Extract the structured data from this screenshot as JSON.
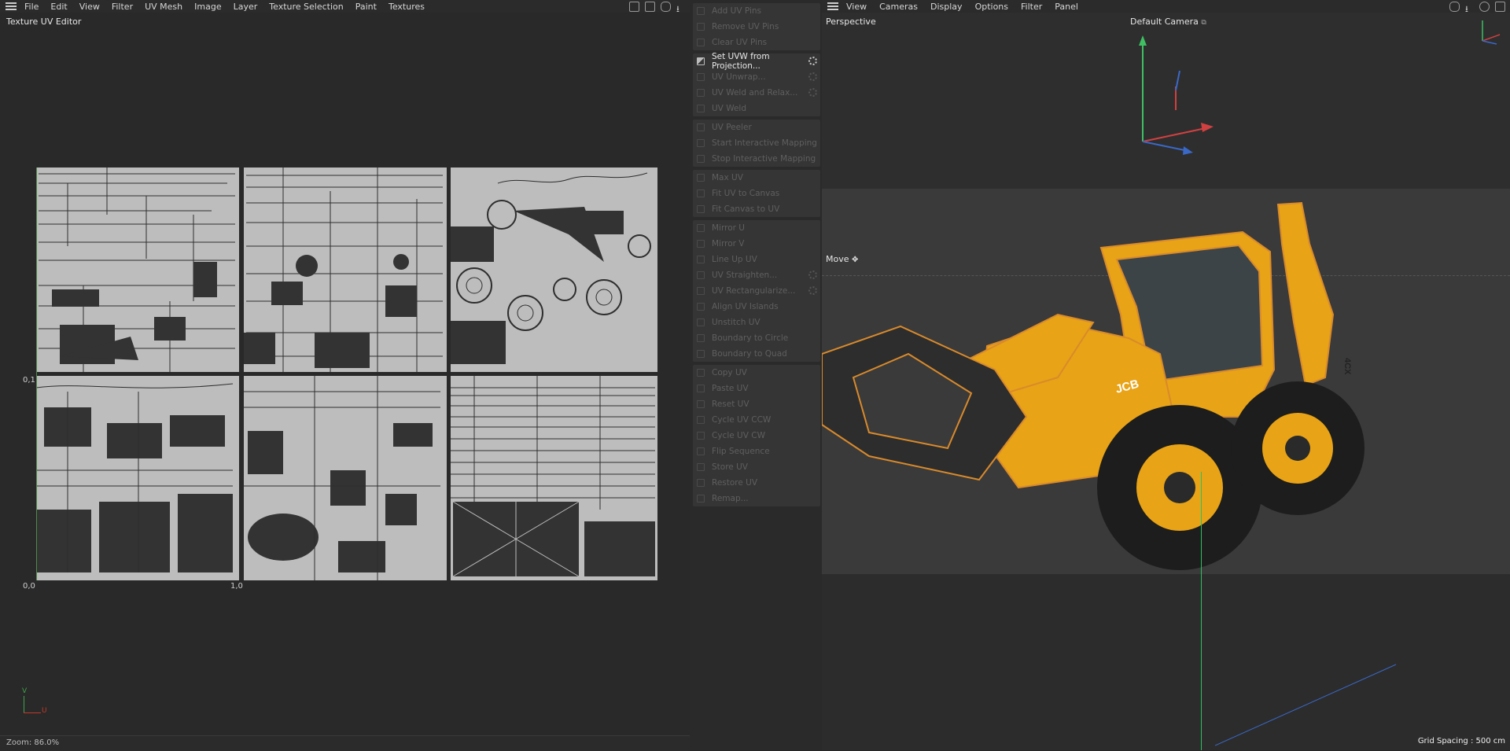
{
  "uv_editor": {
    "menu": [
      "File",
      "Edit",
      "View",
      "Filter",
      "UV Mesh",
      "Image",
      "Layer",
      "Texture Selection",
      "Paint",
      "Textures"
    ],
    "title": "Texture UV Editor",
    "coord_origin": "0,0",
    "coord_u": "1,0",
    "coord_v": "0,1",
    "axis_v": "V",
    "axis_u": "U",
    "zoom": "Zoom: 86.0%",
    "tool_icons": [
      "histogram-icon",
      "lock-icon",
      "hand-icon",
      "down-arrow-icon"
    ]
  },
  "uv_commands": {
    "groups": [
      [
        {
          "label": "Add UV Pins",
          "enabled": false,
          "gear": false
        },
        {
          "label": "Remove UV Pins",
          "enabled": false,
          "gear": false
        },
        {
          "label": "Clear UV Pins",
          "enabled": false,
          "gear": false
        }
      ],
      [
        {
          "label": "Set UVW from Projection...",
          "enabled": true,
          "gear": true
        },
        {
          "label": "UV Unwrap...",
          "enabled": false,
          "gear": true
        },
        {
          "label": "UV Weld and Relax...",
          "enabled": false,
          "gear": true
        },
        {
          "label": "UV Weld",
          "enabled": false,
          "gear": false
        }
      ],
      [
        {
          "label": "UV Peeler",
          "enabled": false,
          "gear": false
        },
        {
          "label": "Start Interactive Mapping",
          "enabled": false,
          "gear": false
        },
        {
          "label": "Stop Interactive Mapping",
          "enabled": false,
          "gear": false
        }
      ],
      [
        {
          "label": "Max UV",
          "enabled": false,
          "gear": false
        },
        {
          "label": "Fit UV to Canvas",
          "enabled": false,
          "gear": false
        },
        {
          "label": "Fit Canvas to UV",
          "enabled": false,
          "gear": false
        }
      ],
      [
        {
          "label": "Mirror U",
          "enabled": false,
          "gear": false
        },
        {
          "label": "Mirror V",
          "enabled": false,
          "gear": false
        },
        {
          "label": "Line Up UV",
          "enabled": false,
          "gear": false
        },
        {
          "label": "UV Straighten...",
          "enabled": false,
          "gear": true
        },
        {
          "label": "UV Rectangularize...",
          "enabled": false,
          "gear": true
        },
        {
          "label": "Align UV Islands",
          "enabled": false,
          "gear": false
        },
        {
          "label": "Unstitch UV",
          "enabled": false,
          "gear": false
        },
        {
          "label": "Boundary to Circle",
          "enabled": false,
          "gear": false
        },
        {
          "label": "Boundary to Quad",
          "enabled": false,
          "gear": false
        }
      ],
      [
        {
          "label": "Copy UV",
          "enabled": false,
          "gear": false
        },
        {
          "label": "Paste UV",
          "enabled": false,
          "gear": false
        },
        {
          "label": "Reset UV",
          "enabled": false,
          "gear": false
        },
        {
          "label": "Cycle UV CCW",
          "enabled": false,
          "gear": false
        },
        {
          "label": "Cycle UV CW",
          "enabled": false,
          "gear": false
        },
        {
          "label": "Flip Sequence",
          "enabled": false,
          "gear": false
        },
        {
          "label": "Store UV",
          "enabled": false,
          "gear": false
        },
        {
          "label": "Restore UV",
          "enabled": false,
          "gear": false
        },
        {
          "label": "Remap...",
          "enabled": false,
          "gear": false
        }
      ]
    ]
  },
  "viewport": {
    "menu": [
      "View",
      "Cameras",
      "Display",
      "Options",
      "Filter",
      "Panel"
    ],
    "view_name": "Perspective",
    "camera": "Default Camera",
    "tool": "Move",
    "grid_spacing": "Grid Spacing : 500 cm",
    "vehicle_brand": "JCB",
    "vehicle_model": "4CX",
    "colors": {
      "body": "#e8a316",
      "outline": "#d98a2b",
      "tire": "#1d1d1d",
      "glass": "#3c4448"
    },
    "nav_icons": [
      "hand-icon",
      "down-arrow-icon",
      "rotate-icon",
      "maximize-icon"
    ]
  }
}
